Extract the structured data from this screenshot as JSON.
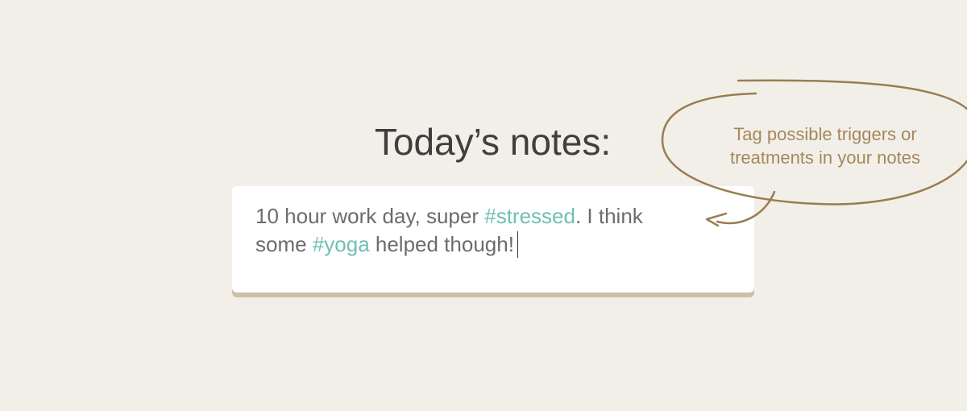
{
  "header": {
    "title": "Today’s notes:"
  },
  "notes": {
    "segments": {
      "s1": "10 hour work day, super ",
      "tag1": "#stressed",
      "s2": ". I think",
      "s3": "some ",
      "tag2": "#yoga",
      "s4": " helped though!"
    }
  },
  "callout": {
    "line1": "Tag possible triggers or",
    "line2": "treatments in your notes"
  },
  "colors": {
    "background": "#f2efe9",
    "title": "#3f3f3f",
    "note_text": "#6c6c6c",
    "hashtag": "#6fbfb3",
    "callout": "#a4885a",
    "card_shadow": "#cdbfa8"
  }
}
